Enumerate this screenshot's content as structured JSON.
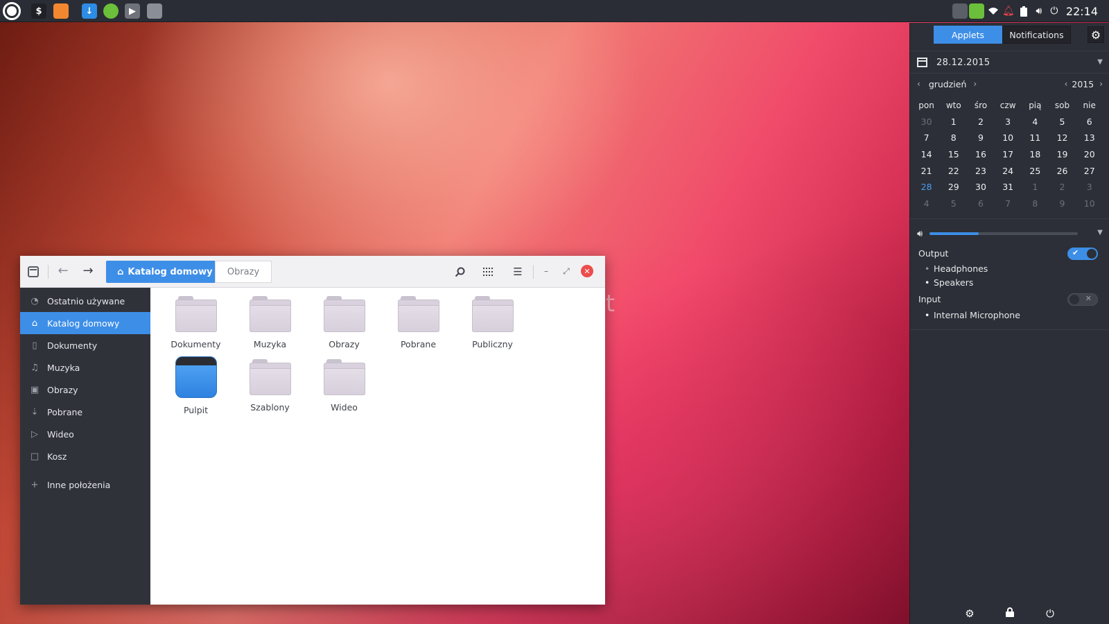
{
  "taskbar": {
    "apps": [
      {
        "name": "terminal-icon",
        "color": "#1f2126"
      },
      {
        "name": "firefox-icon",
        "color": "#f1882f"
      },
      {
        "name": "download-icon",
        "color": "#2d8ce3"
      },
      {
        "name": "green-app-icon",
        "color": "#6bbf3a"
      },
      {
        "name": "media-icon",
        "color": "#6e727a"
      },
      {
        "name": "files-icon",
        "color": "#8a8e96"
      }
    ],
    "clock": "22:14"
  },
  "desktop": {
    "ghost_text": "ct"
  },
  "file_manager": {
    "breadcrumb": {
      "home": "Katalog domowy",
      "next": "Obrazy"
    },
    "sidebar": [
      {
        "label": "Ostatnio używane",
        "icon": "recent-icon",
        "active": false
      },
      {
        "label": "Katalog domowy",
        "icon": "home-icon",
        "active": true
      },
      {
        "label": "Dokumenty",
        "icon": "document-icon",
        "active": false
      },
      {
        "label": "Muzyka",
        "icon": "music-icon",
        "active": false
      },
      {
        "label": "Obrazy",
        "icon": "image-icon",
        "active": false
      },
      {
        "label": "Pobrane",
        "icon": "download-icon",
        "active": false
      },
      {
        "label": "Wideo",
        "icon": "video-icon",
        "active": false
      },
      {
        "label": "Kosz",
        "icon": "trash-icon",
        "active": false
      }
    ],
    "other_locations": "Inne położenia",
    "files": [
      {
        "label": "Dokumenty",
        "type": "folder"
      },
      {
        "label": "Muzyka",
        "type": "folder"
      },
      {
        "label": "Obrazy",
        "type": "folder"
      },
      {
        "label": "Pobrane",
        "type": "folder"
      },
      {
        "label": "Publiczny",
        "type": "folder"
      },
      {
        "label": "Pulpit",
        "type": "desktop"
      },
      {
        "label": "Szablony",
        "type": "folder"
      },
      {
        "label": "Wideo",
        "type": "folder"
      }
    ]
  },
  "side_panel": {
    "tabs": {
      "applets": "Applets",
      "notifications": "Notifications"
    },
    "date": "28.12.2015",
    "month": "grudzień",
    "year": "2015",
    "weekdays": [
      "pon",
      "wto",
      "śro",
      "czw",
      "pią",
      "sob",
      "nie"
    ],
    "weeks": [
      [
        {
          "d": "30",
          "s": "dim"
        },
        {
          "d": "1"
        },
        {
          "d": "2"
        },
        {
          "d": "3"
        },
        {
          "d": "4"
        },
        {
          "d": "5"
        },
        {
          "d": "6"
        }
      ],
      [
        {
          "d": "7"
        },
        {
          "d": "8"
        },
        {
          "d": "9"
        },
        {
          "d": "10"
        },
        {
          "d": "11"
        },
        {
          "d": "12"
        },
        {
          "d": "13"
        }
      ],
      [
        {
          "d": "14"
        },
        {
          "d": "15"
        },
        {
          "d": "16"
        },
        {
          "d": "17"
        },
        {
          "d": "18"
        },
        {
          "d": "19"
        },
        {
          "d": "20"
        }
      ],
      [
        {
          "d": "21"
        },
        {
          "d": "22"
        },
        {
          "d": "23"
        },
        {
          "d": "24"
        },
        {
          "d": "25"
        },
        {
          "d": "26"
        },
        {
          "d": "27"
        }
      ],
      [
        {
          "d": "28",
          "s": "today"
        },
        {
          "d": "29"
        },
        {
          "d": "30"
        },
        {
          "d": "31"
        },
        {
          "d": "1",
          "s": "dim"
        },
        {
          "d": "2",
          "s": "dim"
        },
        {
          "d": "3",
          "s": "dim"
        }
      ],
      [
        {
          "d": "4",
          "s": "dim"
        },
        {
          "d": "5",
          "s": "dim"
        },
        {
          "d": "6",
          "s": "dim"
        },
        {
          "d": "7",
          "s": "dim"
        },
        {
          "d": "8",
          "s": "dim"
        },
        {
          "d": "9",
          "s": "dim"
        },
        {
          "d": "10",
          "s": "dim"
        }
      ]
    ],
    "volume_level": 0.33,
    "output_label": "Output",
    "output_enabled": true,
    "output_devices": [
      "Headphones",
      "Speakers"
    ],
    "input_label": "Input",
    "input_enabled": false,
    "input_devices": [
      "Internal Microphone"
    ],
    "accent": "#3d8ee7"
  }
}
